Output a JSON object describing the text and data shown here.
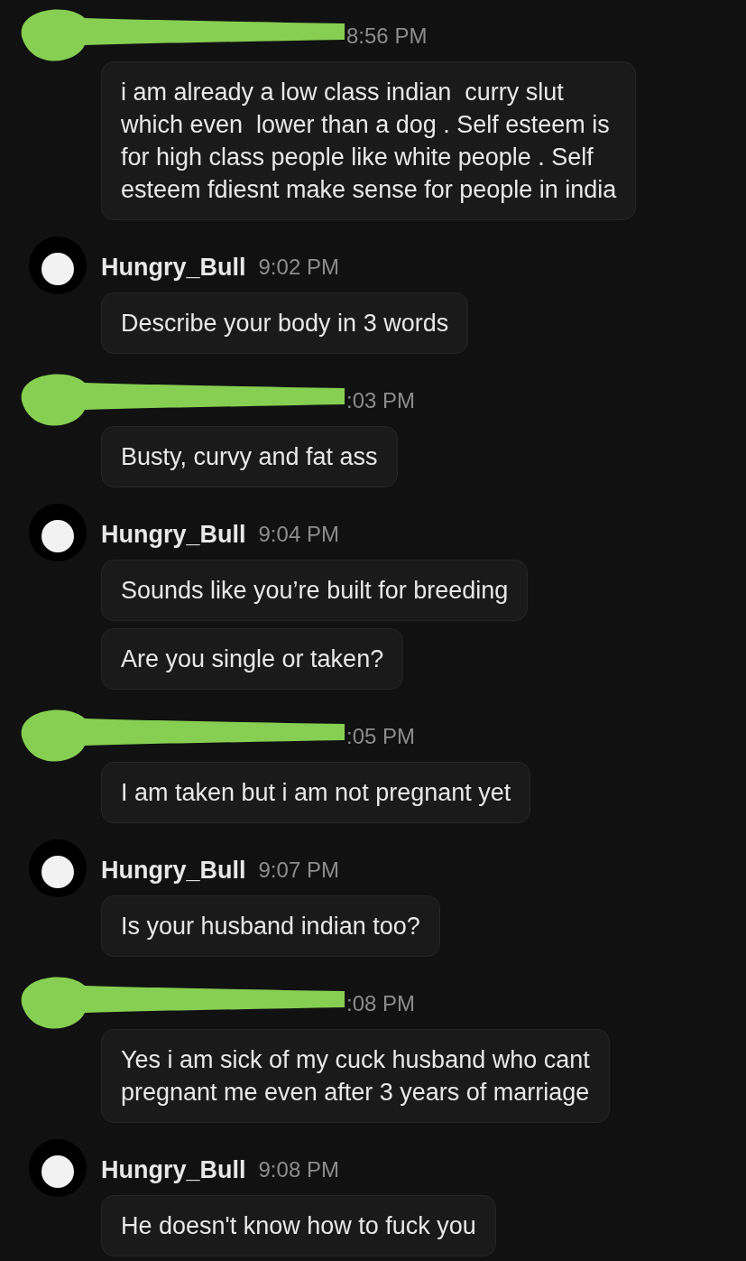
{
  "groups": [
    {
      "kind": "redacted",
      "time": "8:56 PM",
      "messages": [
        "i am already a low class indian  curry slut\nwhich even  lower than a dog . Self esteem is\nfor high class people like white people . Self\nesteem fdiesnt make sense for people in india"
      ]
    },
    {
      "kind": "named",
      "sender": "Hungry_Bull",
      "time": "9:02 PM",
      "messages": [
        "Describe your body in 3 words"
      ]
    },
    {
      "kind": "redacted",
      "time": ":03 PM",
      "messages": [
        "Busty, curvy and fat ass"
      ]
    },
    {
      "kind": "named",
      "sender": "Hungry_Bull",
      "time": "9:04 PM",
      "messages": [
        "Sounds like you’re built for breeding",
        "Are you single or taken?"
      ]
    },
    {
      "kind": "redacted",
      "time": ":05 PM",
      "messages": [
        "I am taken but i am not pregnant yet"
      ]
    },
    {
      "kind": "named",
      "sender": "Hungry_Bull",
      "time": "9:07 PM",
      "messages": [
        "Is your husband indian too?"
      ]
    },
    {
      "kind": "redacted",
      "time": ":08 PM",
      "messages": [
        "Yes i am sick of my cuck husband who cant\npregnant me even after 3 years of marriage"
      ]
    },
    {
      "kind": "named",
      "sender": "Hungry_Bull",
      "time": "9:08 PM",
      "messages": [
        "He doesn't know how to fuck you"
      ]
    }
  ]
}
